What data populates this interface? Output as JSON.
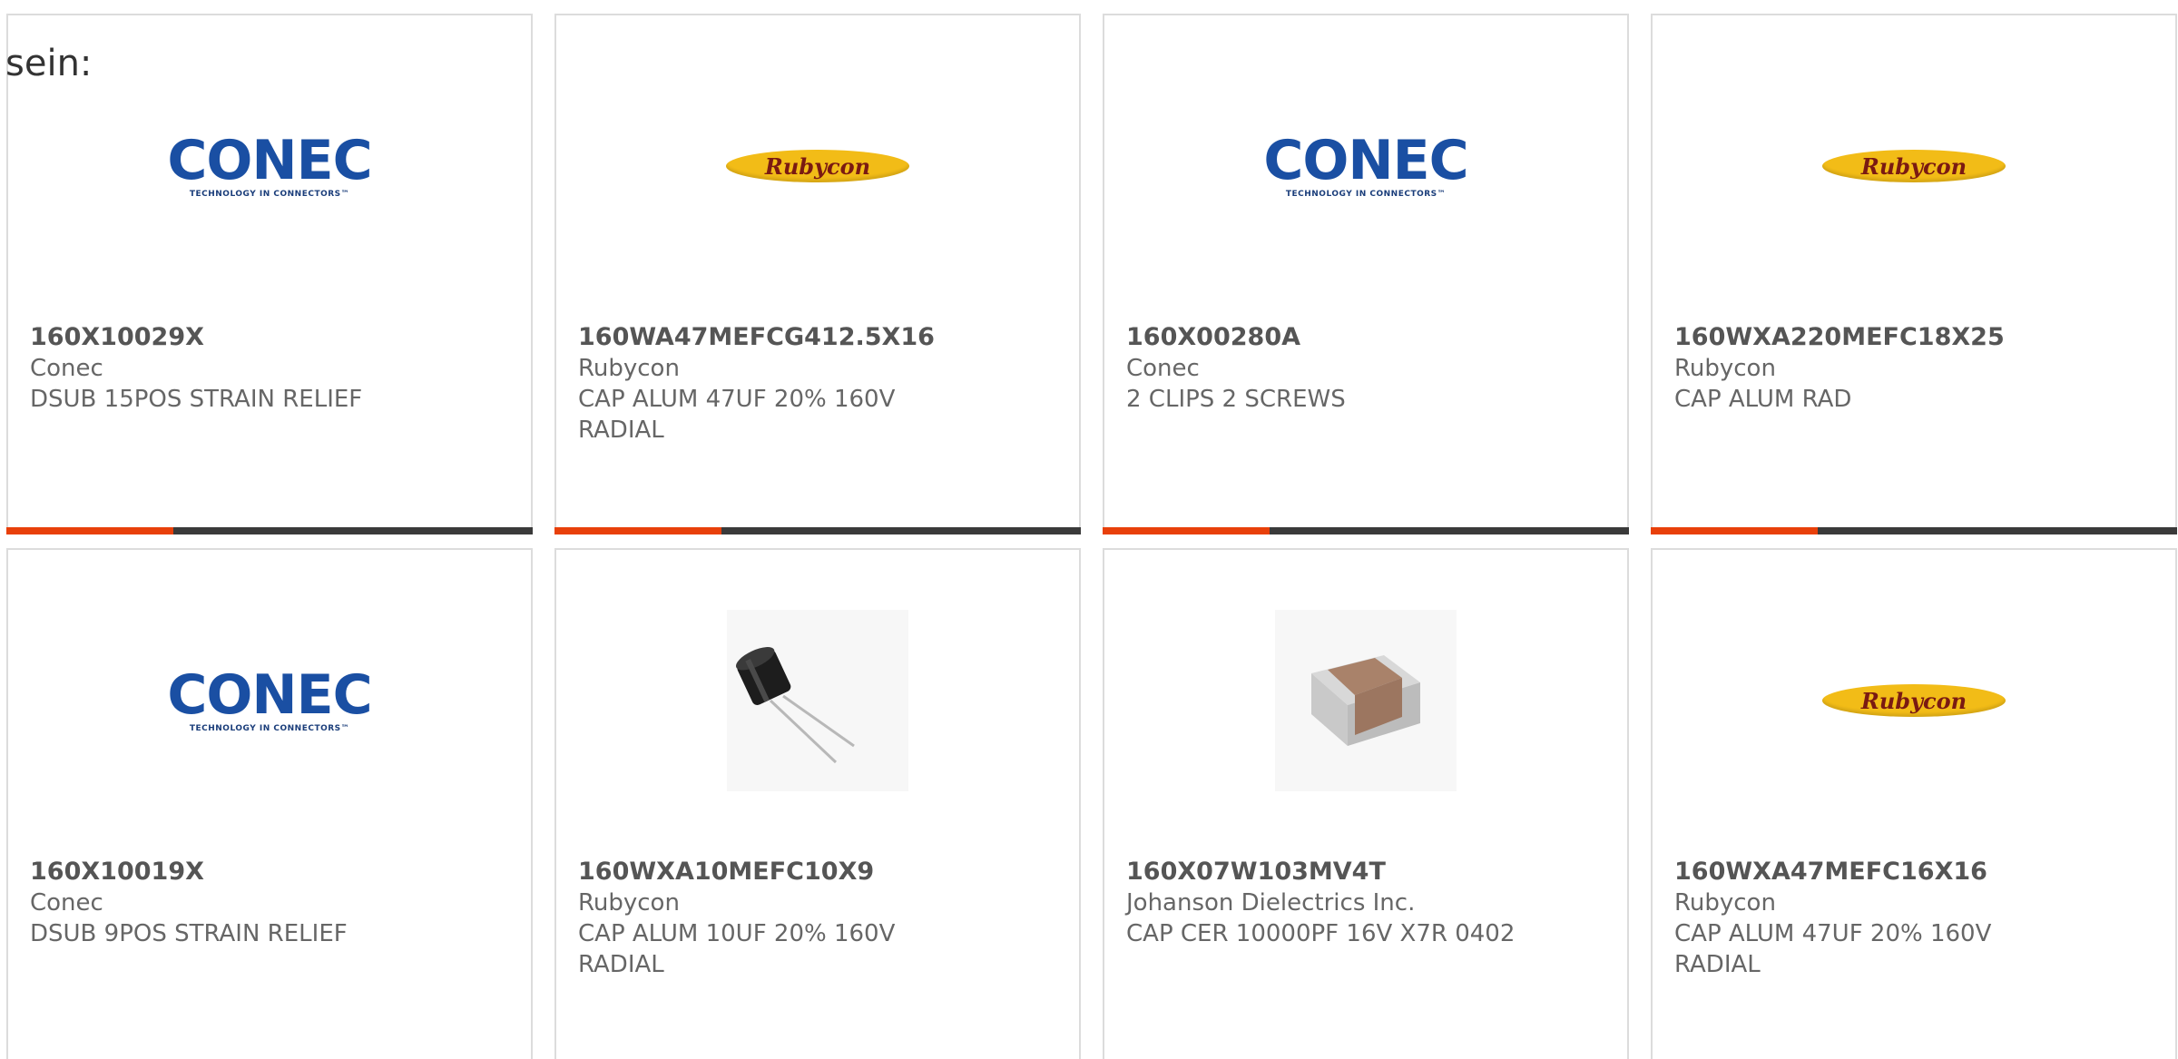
{
  "lead_text": "sein:",
  "logo_text": {
    "conec_word": "CONEC",
    "conec_tagline": "TECHNOLOGY IN CONNECTORS™",
    "rubycon_word": "Rubycon"
  },
  "colors": {
    "accent": "#e8400a",
    "bar": "#3a3a3a",
    "border": "#dcdcdc",
    "conec_blue": "#1a4fa3",
    "rubycon_yellow": "#f2bc17"
  },
  "products": [
    {
      "part_number": "160X10029X",
      "manufacturer": "Conec",
      "description": "DSUB 15POS STRAIN RELIEF",
      "image": "conec-logo"
    },
    {
      "part_number": "160WA47MEFCG412.5X16",
      "manufacturer": "Rubycon",
      "description": "CAP ALUM 47UF 20% 160V RADIAL",
      "image": "rubycon-logo"
    },
    {
      "part_number": "160X00280A",
      "manufacturer": "Conec",
      "description": "2 CLIPS 2 SCREWS",
      "image": "conec-logo"
    },
    {
      "part_number": "160WXA220MEFC18X25",
      "manufacturer": "Rubycon",
      "description": "CAP ALUM RAD",
      "image": "rubycon-logo"
    },
    {
      "part_number": "160X10019X",
      "manufacturer": "Conec",
      "description": "DSUB 9POS STRAIN RELIEF",
      "image": "conec-logo"
    },
    {
      "part_number": "160WXA10MEFC10X9",
      "manufacturer": "Rubycon",
      "description": "CAP ALUM 10UF 20% 160V RADIAL",
      "image": "electrolytic-capacitor-photo"
    },
    {
      "part_number": "160X07W103MV4T",
      "manufacturer": "Johanson Dielectrics Inc.",
      "description": "CAP CER 10000PF 16V X7R 0402",
      "image": "ceramic-chip-capacitor-photo"
    },
    {
      "part_number": "160WXA47MEFC16X16",
      "manufacturer": "Rubycon",
      "description": "CAP ALUM 47UF 20% 160V RADIAL",
      "image": "rubycon-logo"
    }
  ]
}
